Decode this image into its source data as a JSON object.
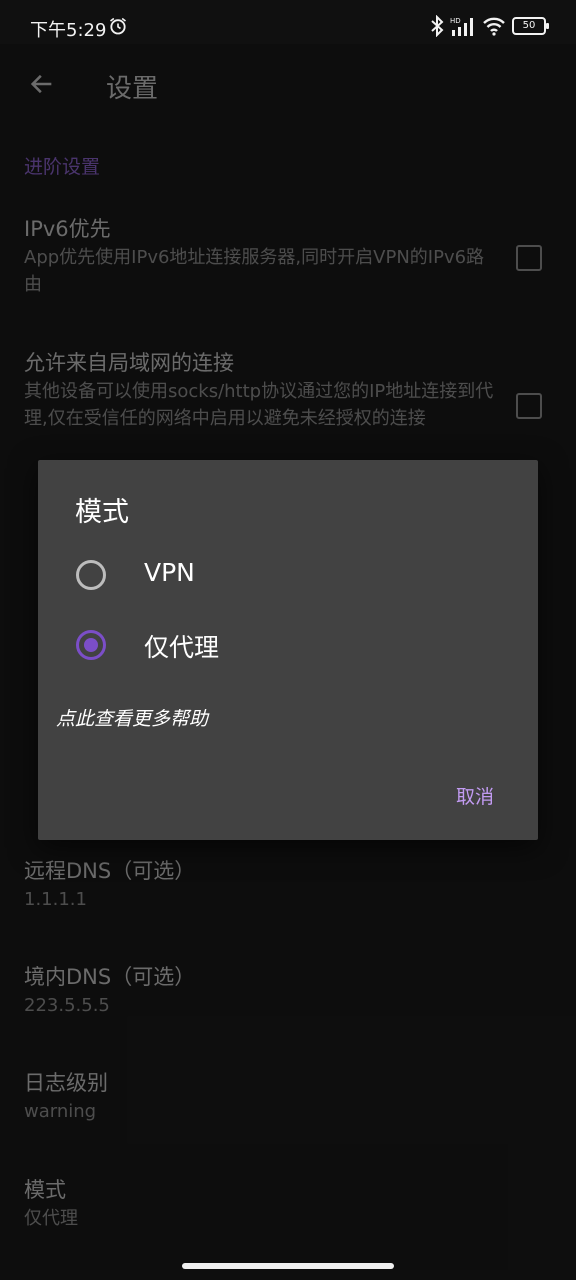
{
  "status_bar": {
    "time": "下午5:29",
    "battery": "50",
    "icons": [
      "alarm-icon",
      "bluetooth-icon",
      "signal-icon",
      "wifi-icon",
      "battery-icon"
    ]
  },
  "app_bar": {
    "title": "设置",
    "back_icon": "arrow-back-icon"
  },
  "section": "进阶设置",
  "prefs": [
    {
      "title": "IPv6优先",
      "summary": "App优先使用IPv6地址连接服务器,同时开启VPN的IPv6路由"
    },
    {
      "title": "允许来自局域网的连接",
      "summary": "其他设备可以使用socks/http协议通过您的IP地址连接到代理,仅在受信任的网络中启用以避免未经授权的连接"
    },
    {
      "title": "远程DNS（可选）",
      "summary": "1.1.1.1"
    },
    {
      "title": "境内DNS（可选）",
      "summary": "223.5.5.5"
    },
    {
      "title": "日志级别",
      "summary": "warning"
    },
    {
      "title": "模式",
      "summary": "仅代理"
    }
  ],
  "dialog": {
    "title": "模式",
    "options": [
      {
        "label": "VPN",
        "selected": false
      },
      {
        "label": "仅代理",
        "selected": true
      }
    ],
    "help": "点此查看更多帮助",
    "cancel": "取消"
  },
  "colors": {
    "accent": "#7b4ec8",
    "button_text": "#c29bf2",
    "dialog_bg": "#424242",
    "page_bg": "#141414"
  }
}
